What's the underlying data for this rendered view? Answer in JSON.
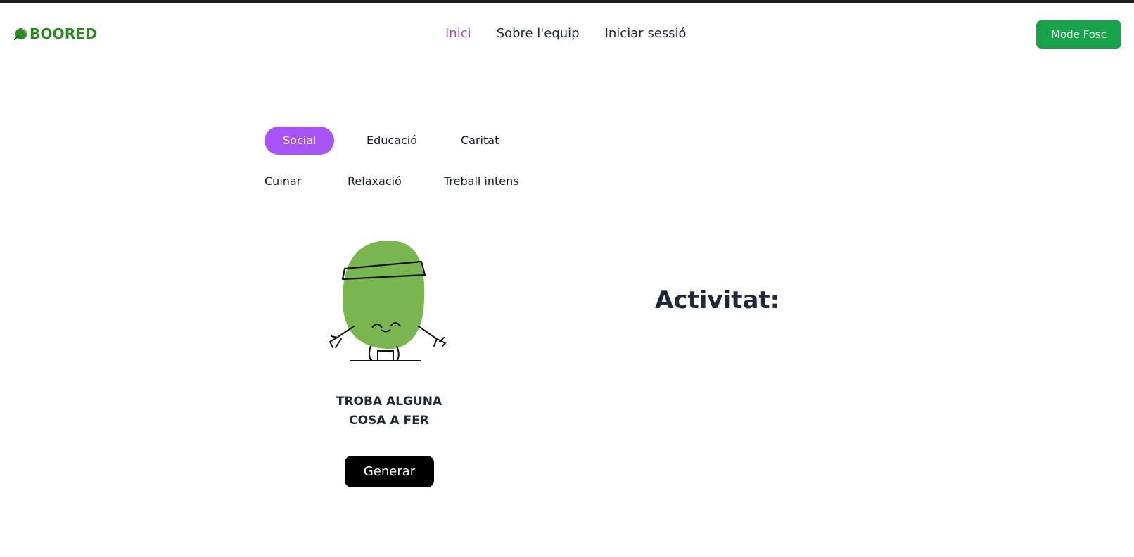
{
  "header": {
    "logo_text": "BOORED",
    "nav": [
      {
        "label": "Inici",
        "active": true
      },
      {
        "label": "Sobre l'equip",
        "active": false
      },
      {
        "label": "Iniciar sessió",
        "active": false
      }
    ],
    "dark_mode_label": "Mode Fosc"
  },
  "categories": {
    "row1": [
      {
        "label": "Social",
        "selected": true
      },
      {
        "label": "Educació",
        "selected": false
      },
      {
        "label": "Caritat",
        "selected": false
      }
    ],
    "row2": [
      {
        "label": "Cuinar",
        "selected": false
      },
      {
        "label": "Relaxació",
        "selected": false
      },
      {
        "label": "Treball intens",
        "selected": false
      }
    ]
  },
  "finder": {
    "prompt_line1": "TROBA ALGUNA",
    "prompt_line2": "COSA A FER",
    "generate_label": "Generar"
  },
  "activity": {
    "title": "Activitat:"
  },
  "colors": {
    "brand_green": "#2e8b23",
    "dark_mode_button": "#16a34a",
    "active_nav": "#9b51e0",
    "selected_category": "#a855f7",
    "mascot_green": "#7ab650"
  },
  "icons": {
    "logo": "green-leaf-blob-icon",
    "mascot": "green-blob-character-illustration"
  }
}
